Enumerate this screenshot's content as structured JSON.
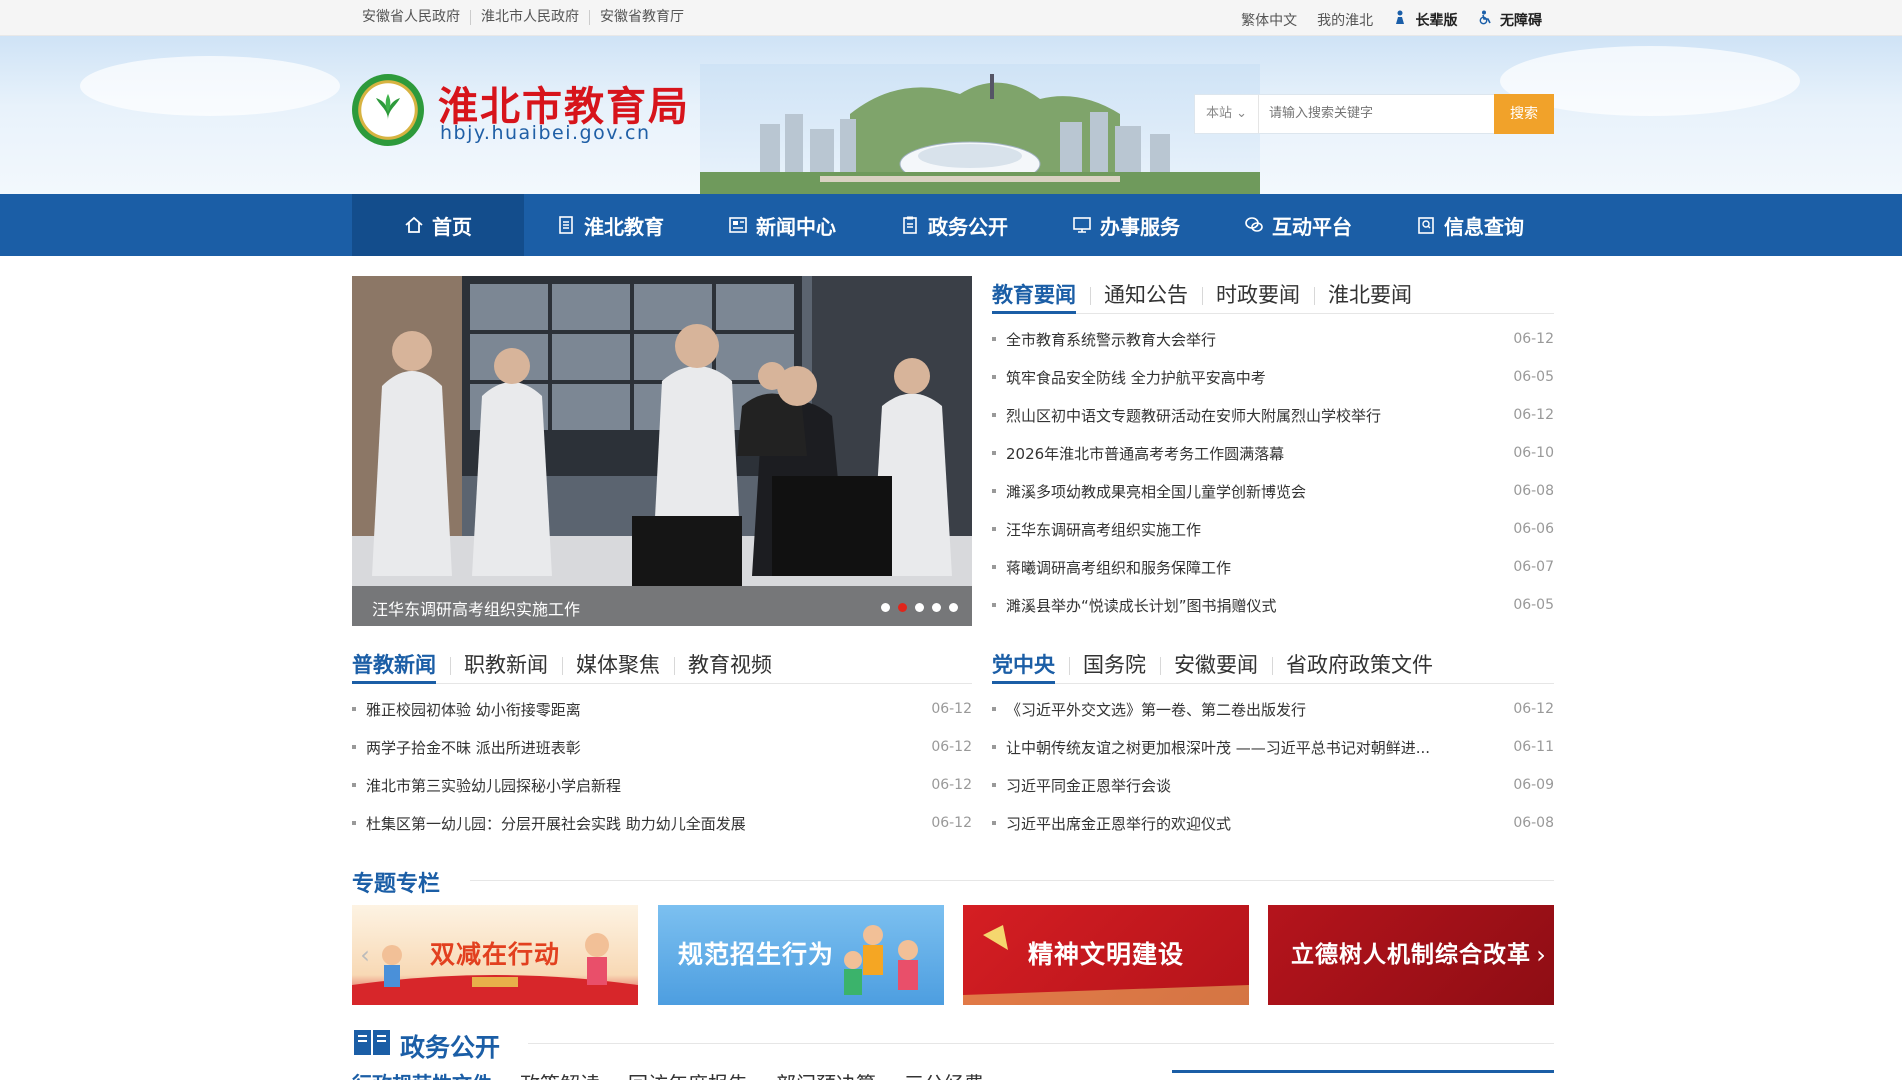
{
  "topbar": {
    "left_links": [
      "安徽省人民政府",
      "淮北市人民政府",
      "安徽省教育厅"
    ],
    "right_links": {
      "traditional": "繁体中文",
      "my": "我的淮北",
      "elder": "长辈版",
      "accessible": "无障碍"
    }
  },
  "header": {
    "title": "淮北市教育局",
    "subtitle": "hbjy.huaibei.gov.cn",
    "search": {
      "scope": "本站",
      "placeholder": "请输入搜索关键字",
      "button": "搜索"
    }
  },
  "nav": {
    "items": [
      {
        "label": "首页",
        "icon": "home-icon"
      },
      {
        "label": "淮北教育",
        "icon": "document-icon"
      },
      {
        "label": "新闻中心",
        "icon": "newspaper-icon"
      },
      {
        "label": "政务公开",
        "icon": "clipboard-icon"
      },
      {
        "label": "办事服务",
        "icon": "monitor-icon"
      },
      {
        "label": "互动平台",
        "icon": "chat-icon"
      },
      {
        "label": "信息查询",
        "icon": "search-doc-icon"
      }
    ]
  },
  "slider": {
    "caption": "汪华东调研高考组织实施工作",
    "dots": 5,
    "active_dot": 1
  },
  "block1": {
    "tabs": [
      "教育要闻",
      "通知公告",
      "时政要闻",
      "淮北要闻"
    ],
    "items": [
      {
        "title": "全市教育系统警示教育大会举行",
        "date": "06-12"
      },
      {
        "title": "筑牢食品安全防线 全力护航平安高中考",
        "date": "06-05"
      },
      {
        "title": "烈山区初中语文专题教研活动在安师大附属烈山学校举行",
        "date": "06-12"
      },
      {
        "title": "2026年淮北市普通高考考务工作圆满落幕",
        "date": "06-10"
      },
      {
        "title": "濉溪多项幼教成果亮相全国儿童学创新博览会",
        "date": "06-08"
      },
      {
        "title": "汪华东调研高考组织实施工作",
        "date": "06-06"
      },
      {
        "title": "蒋曦调研高考组织和服务保障工作",
        "date": "06-07"
      },
      {
        "title": "濉溪县举办“悦读成长计划”图书捐赠仪式",
        "date": "06-05"
      }
    ]
  },
  "block2": {
    "tabs": [
      "普教新闻",
      "职教新闻",
      "媒体聚焦",
      "教育视频"
    ],
    "items": [
      {
        "title": "雅正校园初体验 幼小衔接零距离",
        "date": "06-12"
      },
      {
        "title": "两学子拾金不昧 派出所进班表彰",
        "date": "06-12"
      },
      {
        "title": "淮北市第三实验幼儿园探秘小学启新程",
        "date": "06-12"
      },
      {
        "title": "杜集区第一幼儿园：分层开展社会实践 助力幼儿全面发展",
        "date": "06-12"
      }
    ]
  },
  "block3": {
    "tabs": [
      "党中央",
      "国务院",
      "安徽要闻",
      "省政府政策文件"
    ],
    "items": [
      {
        "title": "《习近平外交文选》第一卷、第二卷出版发行",
        "date": "06-12"
      },
      {
        "title": "让中朝传统友谊之树更加根深叶茂 ——习近平总书记对朝鲜进...",
        "date": "06-11"
      },
      {
        "title": "习近平同金正恩举行会谈",
        "date": "06-09"
      },
      {
        "title": "习近平出席金正恩举行的欢迎仪式",
        "date": "06-08"
      }
    ]
  },
  "special": {
    "title": "专题专栏",
    "banners": [
      {
        "label": "双减在行动",
        "bg": "#fbe9d2",
        "fg": "#e2401f"
      },
      {
        "label": "规范招生行为",
        "bg": "#5aa9e6",
        "fg": "#ffffff"
      },
      {
        "label": "精神文明建设",
        "bg": "#c51a1f",
        "fg": "#ffffff"
      },
      {
        "label": "立德树人机制综合改革",
        "bg": "#a8111a",
        "fg": "#ffffff"
      }
    ]
  },
  "gov": {
    "title": "政务公开",
    "tabs": [
      "行政规范性文件",
      "政策解读",
      "回访年度报告",
      "部门预决算",
      "三公经费"
    ]
  },
  "colors": {
    "primary": "#1b5ea6",
    "title_red": "#d7141b",
    "search_button": "#f1a22a"
  }
}
